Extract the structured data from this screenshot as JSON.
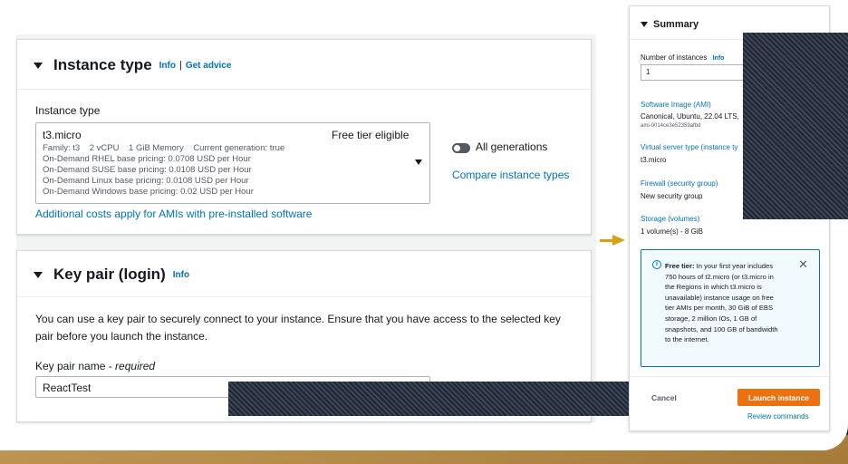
{
  "instance_type": {
    "heading": "Instance type",
    "info": "Info",
    "separator": "|",
    "get_advice": "Get advice",
    "field_label": "Instance type",
    "selected": {
      "name": "t3.micro",
      "free_tier": "Free tier eligible",
      "specs": "Family: t3    2 vCPU    1 GiB Memory    Current generation: true",
      "pricing": [
        "On-Demand RHEL base pricing: 0.0708 USD per Hour",
        "On-Demand SUSE base pricing: 0.0108 USD per Hour",
        "On-Demand Linux base pricing: 0.0108 USD per Hour",
        "On-Demand Windows base pricing: 0.02 USD per Hour"
      ]
    },
    "all_generations": "All generations",
    "all_generations_on": false,
    "compare": "Compare instance types",
    "additional_costs": "Additional costs apply for AMIs with pre-installed software"
  },
  "key_pair": {
    "heading": "Key pair (login)",
    "info": "Info",
    "description": "You can use a key pair to securely connect to your instance. Ensure that you have access to the selected key pair before you launch the instance.",
    "name_label": "Key pair name - ",
    "required": "required",
    "value": "ReactTest"
  },
  "summary": {
    "heading": "Summary",
    "instances_label": "Number of instances",
    "instances_info": "Info",
    "instances_value": "1",
    "ami_label": "Software Image (AMI)",
    "ami_value": "Canonical, Ubuntu, 22.04 LTS,",
    "ami_id": "ami-0014ce3e52359afbd",
    "server_type_label": "Virtual server type (instance ty",
    "server_type_value": "t3.micro",
    "firewall_label": "Firewall (security group)",
    "firewall_value": "New security group",
    "storage_label": "Storage (volumes)",
    "storage_value": "1 volume(s) - 8 GiB",
    "free_tier_title": "Free tier:",
    "free_tier_text": [
      "In your first year includes",
      "750 hours of t2.micro (or t3.micro in",
      "the Regions in which t3.micro is",
      "unavailable) instance usage on free",
      "tier AMIs per month, 30 GiB of EBS",
      "storage, 2 million IOs, 1 GB of",
      "snapshots, and 100 GB of bandwidth",
      "to the internet."
    ],
    "cancel": "Cancel",
    "launch": "Launch instance",
    "review": "Review commands"
  },
  "colors": {
    "link": "#0073bb",
    "launch_button": "#ec7211",
    "arrow": "#d4a017",
    "backdrop": "#0f1b2a"
  }
}
